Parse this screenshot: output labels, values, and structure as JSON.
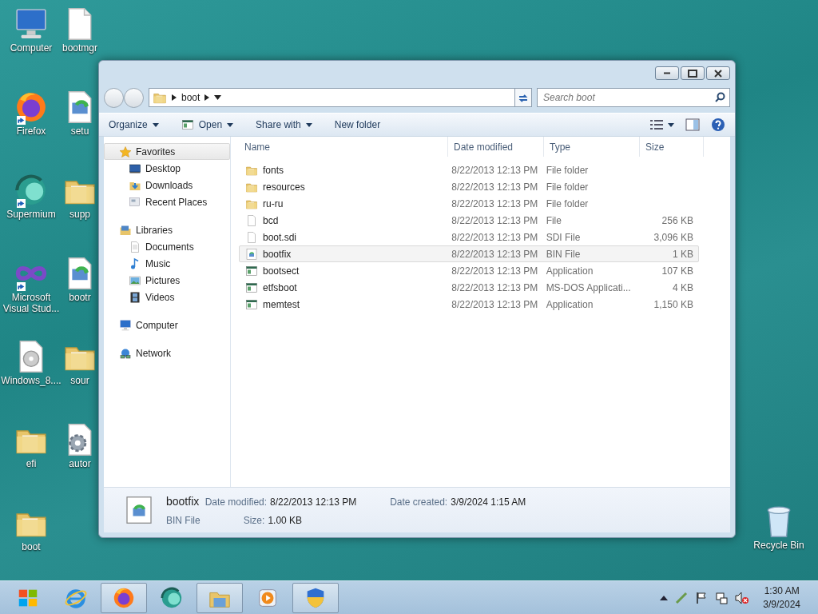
{
  "desktop_icons": [
    {
      "label": "Computer",
      "kind": "computer",
      "shortcut": false
    },
    {
      "label": "Firefox",
      "kind": "firefox",
      "shortcut": true
    },
    {
      "label": "Supermium",
      "kind": "supermium",
      "shortcut": true
    },
    {
      "label": "Microsoft Visual Stud...",
      "kind": "vs",
      "shortcut": true
    },
    {
      "label": "Windows_8....",
      "kind": "disc",
      "shortcut": false
    },
    {
      "label": "efi",
      "kind": "folder",
      "shortcut": false
    },
    {
      "label": "boot",
      "kind": "folder",
      "shortcut": false
    },
    {
      "label": "bootmgr",
      "kind": "file",
      "shortcut": false
    },
    {
      "label": "setu",
      "kind": "setup",
      "shortcut": false
    },
    {
      "label": "supp",
      "kind": "folder",
      "shortcut": false
    },
    {
      "label": "bootr",
      "kind": "setup",
      "shortcut": false
    },
    {
      "label": "sour",
      "kind": "folder",
      "shortcut": false
    },
    {
      "label": "autor",
      "kind": "gear",
      "shortcut": false
    }
  ],
  "recycle_bin": {
    "label": "Recycle Bin"
  },
  "window": {
    "address": {
      "path": [
        "boot"
      ]
    },
    "search": {
      "placeholder": "Search boot"
    },
    "toolbar": [
      {
        "label": "Organize",
        "kind": "menu"
      },
      {
        "label": "Open",
        "kind": "open"
      },
      {
        "label": "Share with",
        "kind": "menu"
      },
      {
        "label": "New folder",
        "kind": "plain"
      }
    ],
    "navigation": [
      {
        "label": "Favorites",
        "kind": "star",
        "selected": true,
        "children": [
          {
            "label": "Desktop",
            "kind": "desktop"
          },
          {
            "label": "Downloads",
            "kind": "downloads"
          },
          {
            "label": "Recent Places",
            "kind": "recent"
          }
        ]
      },
      {
        "label": "Libraries",
        "kind": "libraries",
        "selected": false,
        "children": [
          {
            "label": "Documents",
            "kind": "documents"
          },
          {
            "label": "Music",
            "kind": "music"
          },
          {
            "label": "Pictures",
            "kind": "pictures"
          },
          {
            "label": "Videos",
            "kind": "videos"
          }
        ]
      },
      {
        "label": "Computer",
        "kind": "computer",
        "selected": false
      },
      {
        "label": "Network",
        "kind": "network",
        "selected": false
      }
    ],
    "columns": [
      "Name",
      "Date modified",
      "Type",
      "Size"
    ],
    "rows": [
      {
        "name": "fonts",
        "date": "8/22/2013 12:13 PM",
        "type": "File folder",
        "size": "",
        "kind": "folder",
        "selected": false
      },
      {
        "name": "resources",
        "date": "8/22/2013 12:13 PM",
        "type": "File folder",
        "size": "",
        "kind": "folder",
        "selected": false
      },
      {
        "name": "ru-ru",
        "date": "8/22/2013 12:13 PM",
        "type": "File folder",
        "size": "",
        "kind": "folder",
        "selected": false
      },
      {
        "name": "bcd",
        "date": "8/22/2013 12:13 PM",
        "type": "File",
        "size": "256 KB",
        "kind": "file",
        "selected": false
      },
      {
        "name": "boot.sdi",
        "date": "8/22/2013 12:13 PM",
        "type": "SDI File",
        "size": "3,096 KB",
        "kind": "file",
        "selected": false
      },
      {
        "name": "bootfix",
        "date": "8/22/2013 12:13 PM",
        "type": "BIN File",
        "size": "1 KB",
        "kind": "bin",
        "selected": true
      },
      {
        "name": "bootsect",
        "date": "8/22/2013 12:13 PM",
        "type": "Application",
        "size": "107 KB",
        "kind": "app",
        "selected": false
      },
      {
        "name": "etfsboot",
        "date": "8/22/2013 12:13 PM",
        "type": "MS-DOS Applicati...",
        "size": "4 KB",
        "kind": "app",
        "selected": false
      },
      {
        "name": "memtest",
        "date": "8/22/2013 12:13 PM",
        "type": "Application",
        "size": "1,150 KB",
        "kind": "app",
        "selected": false
      }
    ],
    "details": {
      "name": "bootfix",
      "type": "BIN File",
      "fields": [
        {
          "label": "Date modified:",
          "value": "8/22/2013 12:13 PM"
        },
        {
          "label": "Date created:",
          "value": "3/9/2024 1:15 AM"
        },
        {
          "label": "Size:",
          "value": "1.00 KB"
        }
      ]
    }
  },
  "taskbar": {
    "items": [
      {
        "kind": "start",
        "active": false
      },
      {
        "kind": "ie",
        "active": false
      },
      {
        "kind": "firefox",
        "active": true
      },
      {
        "kind": "supermium",
        "active": false
      },
      {
        "kind": "explorer",
        "active": true
      },
      {
        "kind": "media",
        "active": false
      },
      {
        "kind": "shield",
        "active": true
      }
    ],
    "clock": {
      "time": "1:30 AM",
      "date": "3/9/2024"
    }
  }
}
